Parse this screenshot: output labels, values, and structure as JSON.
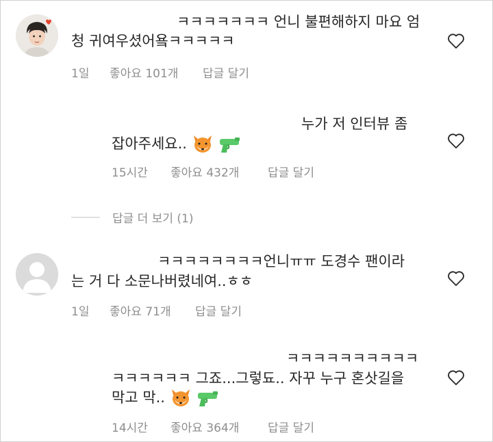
{
  "comments": [
    {
      "line1": "ㅋㅋㅋㅋㅋㅋㅋ 언니 불편해하지 마요 엄",
      "line2": "청 귀여우셨어욬ㅋㅋㅋㅋㅋ",
      "time": "1일",
      "likes": "좋아요 101개",
      "reply": "답글 달기",
      "avatar": "profile-photo"
    },
    {
      "line1": "누가 저 인터뷰 좀",
      "line2": "잡아주세요..",
      "emojis": [
        "fox-emoji",
        "water-pistol-emoji"
      ],
      "time": "15시간",
      "likes": "좋아요 432개",
      "reply": "답글 달기"
    },
    {
      "line1": "ㅋㅋㅋㅋㅋㅋㅋㅋ언니ㅠㅠ 도경수 팬이라",
      "line2": "는 거 다 소문나버렸네여..ㅎㅎ",
      "time": "1일",
      "likes": "좋아요 71개",
      "reply": "답글 달기",
      "avatar": "default-avatar"
    },
    {
      "line1": "ㅋㅋㅋㅋㅋㅋㅋㅋㅋㅋ",
      "line2": "ㅋㅋㅋㅋㅋㅋ 그죠...그렇됴.. 자꾸 누구 혼삿길을",
      "line3": "막고 막..",
      "emojis": [
        "fox-emoji",
        "water-pistol-emoji"
      ],
      "time": "14시간",
      "likes": "좋아요 364개",
      "reply": "답글 달기"
    }
  ],
  "view_more": "답글 더 보기 (1)",
  "colors": {
    "text": "#262626",
    "meta": "#8e8e8e",
    "background": "#ffffff"
  }
}
